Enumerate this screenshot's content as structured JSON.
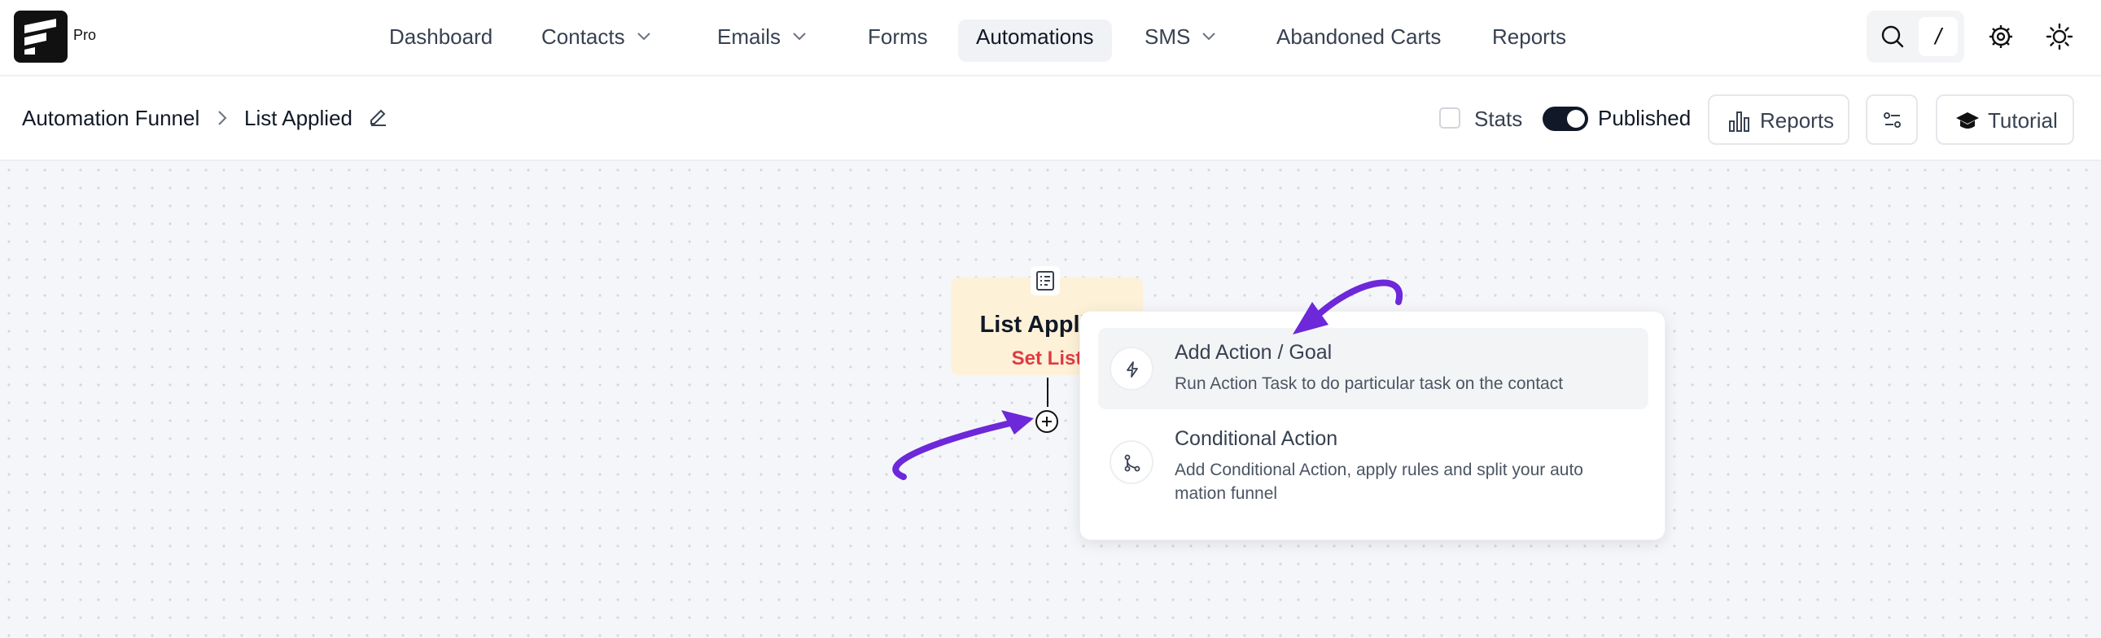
{
  "brand": {
    "badge": "Pro"
  },
  "nav": {
    "items": [
      {
        "label": "Dashboard"
      },
      {
        "label": "Contacts"
      },
      {
        "label": "Emails"
      },
      {
        "label": "Forms"
      },
      {
        "label": "Automations"
      },
      {
        "label": "SMS"
      },
      {
        "label": "Abandoned Carts"
      },
      {
        "label": "Reports"
      }
    ],
    "active": "Automations",
    "shortcut_key": "/"
  },
  "breadcrumb": {
    "root": "Automation Funnel",
    "current": "List Applied"
  },
  "toolbar": {
    "stats_label": "Stats",
    "stats_checked": false,
    "published_label": "Published",
    "published_on": true,
    "reports_label": "Reports",
    "tutorial_label": "Tutorial"
  },
  "node": {
    "title": "List Applied",
    "subtitle": "Set List"
  },
  "menu": {
    "items": [
      {
        "title": "Add Action / Goal",
        "description": "Run Action Task to do particular task on the contact",
        "icon": "bolt-icon"
      },
      {
        "title": "Conditional Action",
        "description": "Add Conditional Action, apply rules and split your auto mation funnel",
        "icon": "branch-icon"
      }
    ]
  },
  "colors": {
    "annotation_arrow": "#6d28d9",
    "node_bg": "#fdf1d7",
    "node_subtitle": "#e03b44",
    "accent_dark": "#111827"
  }
}
